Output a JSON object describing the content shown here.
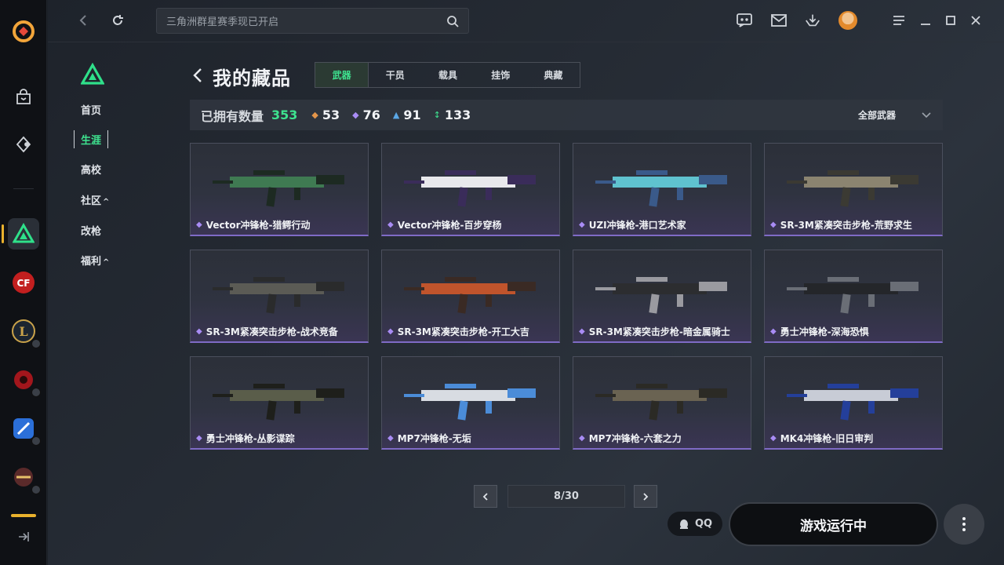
{
  "app": {
    "window_controls": [
      "feedback",
      "mail",
      "download",
      "avatar",
      "menu",
      "minimize",
      "maximize",
      "close"
    ]
  },
  "search": {
    "placeholder": "三角洲群星赛季现已开启"
  },
  "subnav": {
    "items": [
      {
        "label": "首页",
        "active": false
      },
      {
        "label": "生涯",
        "active": true
      },
      {
        "label": "高校",
        "active": false
      },
      {
        "label": "社区",
        "active": false,
        "caret": "^"
      },
      {
        "label": "改枪",
        "active": false
      },
      {
        "label": "福利",
        "active": false,
        "caret": "^"
      }
    ]
  },
  "page": {
    "title": "我的藏品",
    "tabs": [
      "武器",
      "干员",
      "载具",
      "挂饰",
      "典藏"
    ],
    "active_tab": "武器"
  },
  "stats": {
    "owned_label": "已拥有数量",
    "owned_total": "353",
    "tiers": [
      {
        "icon": "orange-gem-icon",
        "color": "#e4954a",
        "value": "53"
      },
      {
        "icon": "purple-gem-icon",
        "color": "#a98cf5",
        "value": "76"
      },
      {
        "icon": "blue-gem-icon",
        "color": "#5aa7e6",
        "value": "91"
      },
      {
        "icon": "green-gem-icon",
        "color": "#3ee28f",
        "value": "133"
      }
    ],
    "filter_label": "全部武器"
  },
  "items": [
    {
      "name": "Vector冲锋枪-猎鳄行动",
      "body": "#3f7a52",
      "accent": "#1d2a22"
    },
    {
      "name": "Vector冲锋枪-百步穿杨",
      "body": "#e8e8ec",
      "accent": "#3a2c5a"
    },
    {
      "name": "UZI冲锋枪-港口艺术家",
      "body": "#5fc2cf",
      "accent": "#3a5a8a"
    },
    {
      "name": "SR-3M紧凑突击步枪-荒野求生",
      "body": "#8b8470",
      "accent": "#3b3a33"
    },
    {
      "name": "SR-3M紧凑突击步枪-战术竞备",
      "body": "#5b5b55",
      "accent": "#2a2b2c"
    },
    {
      "name": "SR-3M紧凑突击步枪-开工大吉",
      "body": "#c0542c",
      "accent": "#3a2a24"
    },
    {
      "name": "SR-3M紧凑突击步枪-暗金属骑士",
      "body": "#2c2d30",
      "accent": "#9a9aa0"
    },
    {
      "name": "勇士冲锋枪-深海恐惧",
      "body": "#24262a",
      "accent": "#6a6e76"
    },
    {
      "name": "勇士冲锋枪-丛影谍踪",
      "body": "#5a5d4a",
      "accent": "#1e1f1b"
    },
    {
      "name": "MP7冲锋枪-无垢",
      "body": "#d8dce2",
      "accent": "#4b8cd8"
    },
    {
      "name": "MP7冲锋枪-六套之力",
      "body": "#6a6352",
      "accent": "#2b2a25"
    },
    {
      "name": "MK4冲锋枪-旧日审判",
      "body": "#c8ccd6",
      "accent": "#243f9a"
    }
  ],
  "pager": {
    "label": "8/30"
  },
  "footer": {
    "qq_label": "QQ",
    "launch_label": "游戏运行中"
  }
}
